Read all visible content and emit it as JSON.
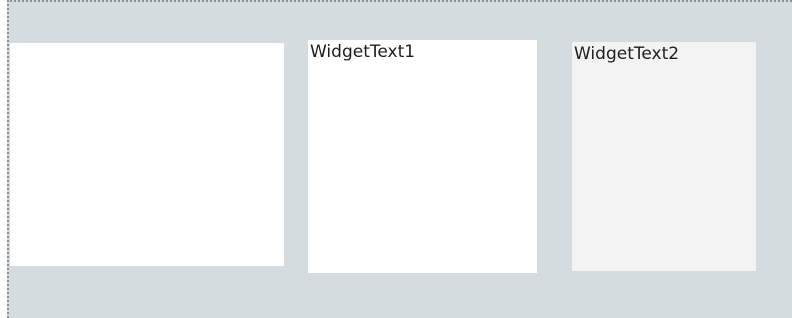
{
  "panels": [
    {
      "text": ""
    },
    {
      "text": "WidgetText1"
    },
    {
      "text": "WidgetText2"
    }
  ],
  "colors": {
    "canvas_background": "#d5dcdf",
    "panel_white": "#ffffff",
    "panel_gray": "#f3f3f3",
    "text": "#1e1e1e"
  }
}
